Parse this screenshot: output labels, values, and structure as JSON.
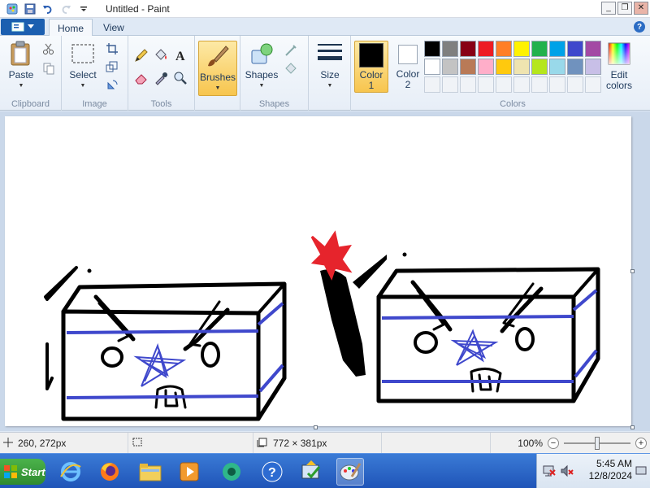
{
  "window": {
    "title": "Untitled - Paint",
    "controls": {
      "minimize": "_",
      "maximize": "❐",
      "close": "✕"
    }
  },
  "tabs": [
    {
      "label": "Home",
      "active": true
    },
    {
      "label": "View",
      "active": false
    }
  ],
  "help_label": "?",
  "ribbon": {
    "clipboard": {
      "label": "Clipboard",
      "paste": "Paste"
    },
    "image": {
      "label": "Image",
      "select": "Select"
    },
    "tools": {
      "label": "Tools"
    },
    "brushes": {
      "label": "Brushes"
    },
    "shapes": {
      "label": "Shapes",
      "shapes_btn": "Shapes"
    },
    "size": {
      "label": "Size"
    },
    "colors": {
      "label": "Colors",
      "color1_line1": "Color",
      "color1_line2": "1",
      "color2_line1": "Color",
      "color2_line2": "2",
      "edit_line1": "Edit",
      "edit_line2": "colors",
      "color1_value": "#000000",
      "color2_value": "#ffffff",
      "palette_row1": [
        "#000000",
        "#7f7f7f",
        "#880015",
        "#ed1c24",
        "#ff7f27",
        "#fff200",
        "#22b14c",
        "#00a2e8",
        "#3f48cc",
        "#a349a4"
      ],
      "palette_row2": [
        "#ffffff",
        "#c3c3c3",
        "#b97a57",
        "#ffaec9",
        "#ffc90e",
        "#efe4b0",
        "#b5e61d",
        "#99d9ea",
        "#7092be",
        "#c8bfe7"
      ]
    }
  },
  "status": {
    "cursor_pos": "260, 272px",
    "selection_size": "",
    "canvas_size": "772 × 381px",
    "zoom": "100%",
    "zoom_fraction": 0.5
  },
  "taskbar": {
    "start_label": "Start",
    "time": "5:45 AM",
    "date": "12/8/2024"
  },
  "drawing": {
    "box_outline": "#000000",
    "stripe_color": "#3f48cc",
    "flame_color": "#e6242c"
  }
}
